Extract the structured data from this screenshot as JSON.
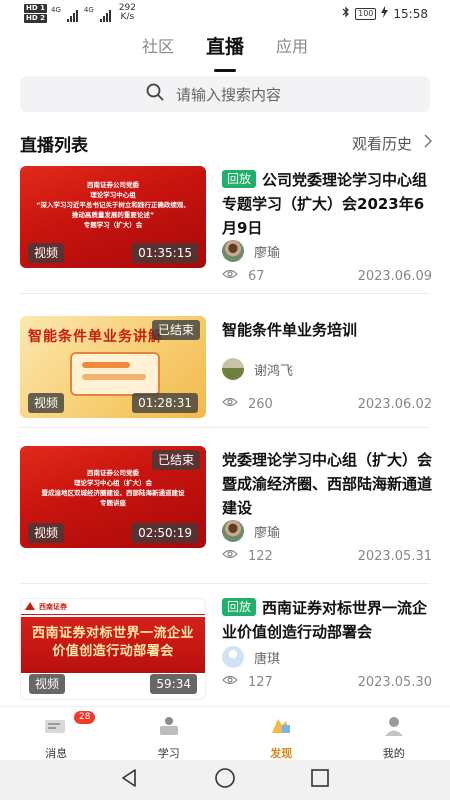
{
  "status_bar": {
    "sim1": "HD 1",
    "sim2": "HD 2",
    "net1": "4G",
    "net2": "4G",
    "speed_value": "292",
    "speed_unit": "K/s",
    "battery": "100",
    "time": "15:58"
  },
  "top_tabs": [
    {
      "label": "社区",
      "active": false
    },
    {
      "label": "直播",
      "active": true
    },
    {
      "label": "应用",
      "active": false
    }
  ],
  "search": {
    "placeholder": "请输入搜索内容"
  },
  "section": {
    "title": "直播列表",
    "history_label": "观看历史"
  },
  "items": [
    {
      "thumb_text": "西南证券公司党委\n理论学习中心组\n“深入学习习近平总书记关于树立和践行正确政绩观、\n推动高质量发展的重要论述”\n专题学习（扩大）会",
      "tag": "回放",
      "title": "公司党委理论学习中心组专题学习（扩大）会2023年6月9日",
      "video_label": "视频",
      "duration": "01:35:15",
      "ended_label": "",
      "author": "廖瑜",
      "views": "67",
      "date": "2023.06.09"
    },
    {
      "thumb_text": "智能条件单业务讲解",
      "tag": "",
      "title": "智能条件单业务培训",
      "video_label": "视频",
      "duration": "01:28:31",
      "ended_label": "已结束",
      "author": "谢鸿飞",
      "views": "260",
      "date": "2023.06.02"
    },
    {
      "thumb_text": "西南证券公司党委\n理论学习中心组（扩大）会\n暨成渝地区双城经济圈建设、西部陆海新通道建设\n专题讲座",
      "tag": "",
      "title": "党委理论学习中心组（扩大）会暨成渝经济圈、西部陆海新通道建设",
      "video_label": "视频",
      "duration": "02:50:19",
      "ended_label": "已结束",
      "author": "廖瑜",
      "views": "122",
      "date": "2023.05.31"
    },
    {
      "thumb_text": "西南证券对标世界一流企业\n价值创造行动部署会",
      "thumb_logo": "西南证券",
      "tag": "回放",
      "title": "西南证券对标世界一流企业价值创造行动部署会",
      "video_label": "视频",
      "duration": "59:34",
      "ended_label": "",
      "author": "唐琪",
      "views": "127",
      "date": "2023.05.30"
    }
  ],
  "bottom_nav": [
    {
      "label": "消息",
      "badge": "28",
      "icon": "message-icon",
      "active": false
    },
    {
      "label": "学习",
      "badge": "",
      "icon": "study-icon",
      "active": false
    },
    {
      "label": "发现",
      "badge": "",
      "icon": "discover-icon",
      "active": true
    },
    {
      "label": "我的",
      "badge": "",
      "icon": "profile-icon",
      "active": false
    }
  ],
  "colors": {
    "accent_green": "#1fb06a",
    "nav_active": "#d88a14",
    "badge_red": "#ef3b2c"
  }
}
